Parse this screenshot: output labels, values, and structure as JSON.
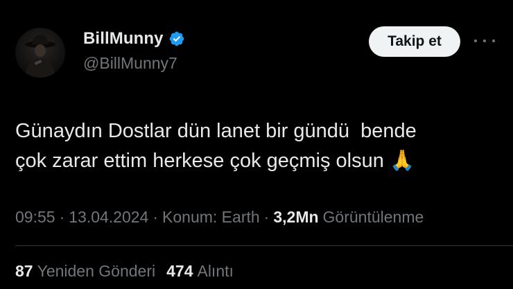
{
  "author": {
    "display_name": "BillMunny",
    "handle": "@BillMunny7",
    "verified_icon": "verified-badge-icon",
    "verified_color": "#1d9bf0"
  },
  "actions": {
    "follow_label": "Takip et",
    "more_icon": "more-horizontal-icon"
  },
  "tweet": {
    "text_line1": "Günaydın Dostlar dün lanet bir gündü  bende",
    "text_line2": "çok zarar ettim herkese çok geçmiş olsun",
    "emoji": "🙏"
  },
  "meta": {
    "time": "09:55",
    "date": "13.04.2024",
    "location": "Konum: Earth",
    "views_count": "3,2Mn",
    "views_label": "Görüntülenme",
    "separator": "·"
  },
  "stats": {
    "reposts_count": "87",
    "reposts_label": "Yeniden Gönderi",
    "quotes_count": "474",
    "quotes_label": "Alıntı"
  },
  "colors": {
    "background": "#000000",
    "primary_text": "#e7e9ea",
    "secondary_text": "#71767b",
    "button_bg": "#eff3f4",
    "divider": "#2f3336"
  }
}
